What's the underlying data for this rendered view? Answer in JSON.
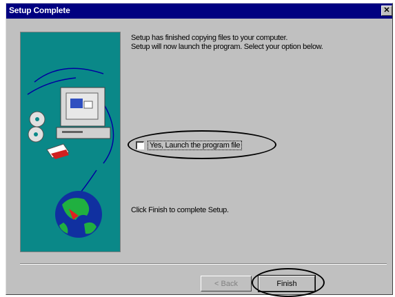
{
  "window": {
    "title": "Setup Complete",
    "close_glyph": "✕"
  },
  "content": {
    "message_line1": "Setup has finished copying files to your computer.",
    "message_line2": "Setup will now launch the program. Select your option below.",
    "checkbox_label": "Yes, Launch the program file",
    "checkbox_checked": false,
    "footer": "Click Finish to complete Setup."
  },
  "buttons": {
    "back": "< Back",
    "finish": "Finish"
  },
  "colors": {
    "title_bar": "#000080",
    "dialog_bg": "#c0c0c0",
    "illustration_bg": "#0a8888"
  }
}
